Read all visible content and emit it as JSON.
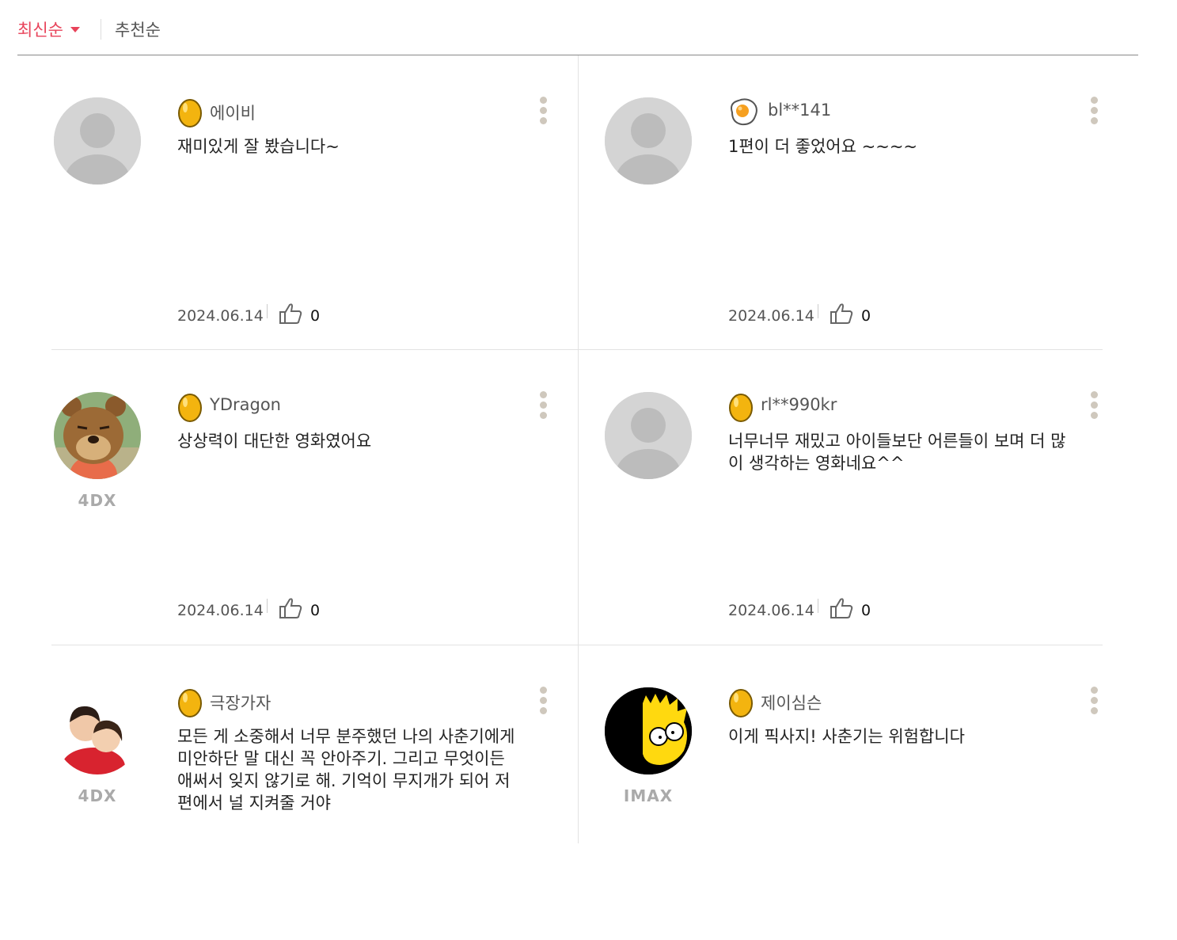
{
  "sort": {
    "latest": "최신순",
    "recommended": "추천순"
  },
  "reviews": [
    {
      "nickname": "에이비",
      "text": "재미있게 잘 봤습니다~",
      "date": "2024.06.14",
      "likes": "0",
      "grade": "gold-egg-icon",
      "avatar": "default-avatar",
      "badge": ""
    },
    {
      "nickname": "bl**141",
      "text": "1편이 더 좋었어요 ~~~~",
      "date": "2024.06.14",
      "likes": "0",
      "grade": "fried-egg-icon",
      "avatar": "default-avatar",
      "badge": ""
    },
    {
      "nickname": "YDragon",
      "text": "상상력이 대단한 영화였어요",
      "date": "2024.06.14",
      "likes": "0",
      "grade": "gold-egg-icon",
      "avatar": "bear-character-photo",
      "badge": "4DX"
    },
    {
      "nickname": "rl**990kr",
      "text": "너무너무 재밌고 아이들보단 어른들이 보며 더 많이 생각하는 영화네요^^",
      "date": "2024.06.14",
      "likes": "0",
      "grade": "gold-egg-icon",
      "avatar": "default-avatar",
      "badge": ""
    },
    {
      "nickname": "극장가자",
      "text": "모든 게 소중해서 너무 분주했던 나의 사춘기에게 미안하단 말 대신 꼭 안아주기. 그리고 무엇이든 애써서 잊지 않기로 해. 기억이 무지개가 되어 저편에서 널 지켜줄 거야",
      "date": "",
      "likes": "",
      "grade": "gold-egg-icon",
      "avatar": "couple-photo",
      "badge": "4DX"
    },
    {
      "nickname": "제이심슨",
      "text": "이게 픽사지! 사춘기는 위험합니다",
      "date": "",
      "likes": "",
      "grade": "gold-egg-icon",
      "avatar": "bart-simpson-cartoon",
      "badge": "IMAX"
    }
  ],
  "colors": {
    "accent": "#e8435a",
    "gold": "#f3b40f",
    "divider": "#e2e2e2"
  }
}
